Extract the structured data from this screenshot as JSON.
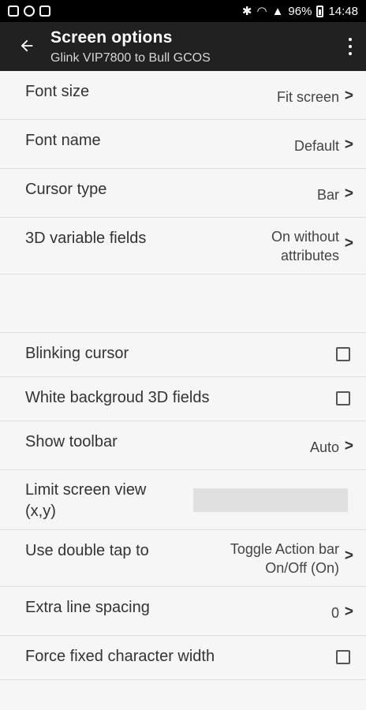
{
  "status": {
    "battery_pct": "96%",
    "time": "14:48"
  },
  "appbar": {
    "title": "Screen options",
    "subtitle": "Glink VIP7800 to Bull GCOS"
  },
  "rows": {
    "font_size": {
      "label": "Font size",
      "value": "Fit screen"
    },
    "font_name": {
      "label": "Font name",
      "value": "Default"
    },
    "cursor_type": {
      "label": "Cursor type",
      "value": "Bar"
    },
    "variable_3d": {
      "label": "3D variable fields",
      "value_line1": "On without",
      "value_line2": "attributes"
    },
    "blinking_cursor": {
      "label": "Blinking cursor"
    },
    "white_bg": {
      "label": "White backgroud 3D fields"
    },
    "show_toolbar": {
      "label": "Show toolbar",
      "value": "Auto"
    },
    "limit_view": {
      "label_line1": "Limit screen view",
      "label_line2": "(x,y)",
      "value": ""
    },
    "double_tap": {
      "label": "Use double tap to",
      "value_line1": "Toggle Action bar",
      "value_line2": "On/Off (On)"
    },
    "line_spacing": {
      "label": "Extra  line spacing",
      "value": "0"
    },
    "fixed_width": {
      "label": "Force fixed character width"
    }
  },
  "chevron_glyph": ">"
}
